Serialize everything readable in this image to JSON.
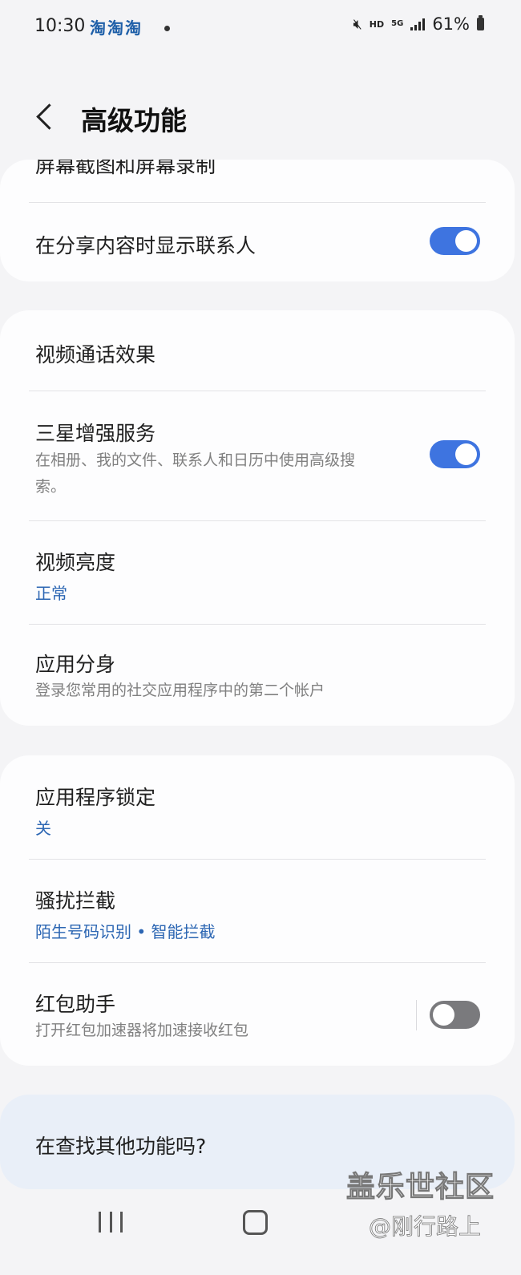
{
  "status_bar": {
    "time": "10:30",
    "notification_apps": "淘淘淘",
    "hd": "HD",
    "network": "5G",
    "battery": "61%"
  },
  "header": {
    "title": "高级功能"
  },
  "group1": {
    "partial_item_title": "屏幕截图和屏幕录制",
    "item_contacts": {
      "title": "在分享内容时显示联系人",
      "toggle": "on"
    }
  },
  "group2": {
    "video_call_effects": {
      "title": "视频通话效果"
    },
    "samsung_enhanced": {
      "title": "三星增强服务",
      "description_line1": "在相册、我的文件、联系人和日历中使用高级搜",
      "description_line2": "索。",
      "toggle": "on"
    },
    "video_brightness": {
      "title": "视频亮度",
      "value": "正常"
    },
    "dual_messenger": {
      "title": "应用分身",
      "description": "登录您常用的社交应用程序中的第二个帐户"
    }
  },
  "group3": {
    "app_lock": {
      "title": "应用程序锁定",
      "value": "关"
    },
    "harassment_block": {
      "title": "骚扰拦截",
      "value": "陌生号码识别 • 智能拦截"
    },
    "red_packet": {
      "title": "红包助手",
      "description": "打开红包加速器将加速接收红包",
      "toggle": "off"
    }
  },
  "looking_for": {
    "text": "在查找其他功能吗?"
  },
  "watermark": {
    "line1": "盖乐世社区",
    "line2": "@刚行路上"
  },
  "colors": {
    "accent": "#3e74e0",
    "link": "#2c66b3",
    "background": "#f4f4f6",
    "card": "#fdfdfe"
  }
}
